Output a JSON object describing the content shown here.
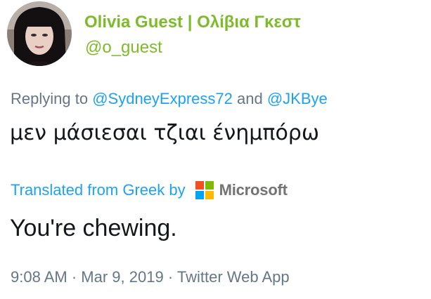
{
  "user": {
    "name": "Olivia Guest | Ολίβια Γκεστ",
    "handle": "@o_guest"
  },
  "reply": {
    "prefix": "Replying to",
    "mention1": "@SydneyExpress72",
    "joiner": "and",
    "mention2": "@JKBye"
  },
  "tweet": {
    "text": "μεν μάσιεσαι τζιαι ένημπόρω"
  },
  "translation": {
    "label": "Translated from Greek by",
    "provider": "Microsoft",
    "text": "You're chewing."
  },
  "meta": {
    "time": "9:08 AM",
    "date": "Mar 9, 2019",
    "source": "Twitter Web App",
    "separator": "·"
  },
  "colors": {
    "name_green": "#7dbb2a",
    "link_blue": "#1da1f2",
    "secondary_gray": "#657786",
    "ms_red": "#f25022",
    "ms_green": "#7fba00",
    "ms_blue": "#00a4ef",
    "ms_yellow": "#ffb900"
  }
}
